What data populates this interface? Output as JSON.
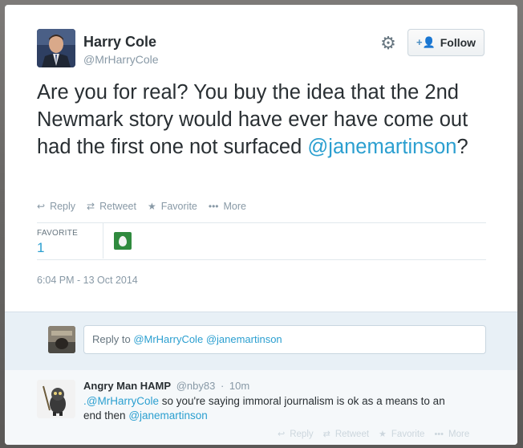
{
  "author": {
    "name": "Harry Cole",
    "handle": "@MrHarryCole"
  },
  "header": {
    "settings_icon": "gear-icon",
    "follow_label": "Follow",
    "follow_icon": "add-user-icon"
  },
  "tweet": {
    "text": "Are you for real? You buy the idea that the 2nd Newmark story would have ever have come out had the first one not surfaced ",
    "mention": "@janemartinson",
    "trailing": "?"
  },
  "actions": {
    "reply": "Reply",
    "retweet": "Retweet",
    "favorite": "Favorite",
    "more": "More"
  },
  "stats": {
    "label": "FAVORITE",
    "value": "1"
  },
  "timestamp": "6:04 PM - 13 Oct 2014",
  "reply_box": {
    "prefix": "Reply to ",
    "mention1": "@MrHarryCole",
    "mention2": "@janemartinson"
  },
  "reply": {
    "name": "Angry Man HAMP",
    "handle": "@nby83",
    "time": "10m",
    "mention_start": ".@MrHarryCole",
    "text": " so you're saying immoral journalism is ok as a means to an end then ",
    "mention_end": "@janemartinson",
    "actions": {
      "reply": "Reply",
      "retweet": "Retweet",
      "favorite": "Favorite",
      "more": "More"
    }
  },
  "colors": {
    "link": "#2b9fd0",
    "muted": "#8899a6",
    "text": "#292f33",
    "reply_panel": "#e8f0f6"
  }
}
